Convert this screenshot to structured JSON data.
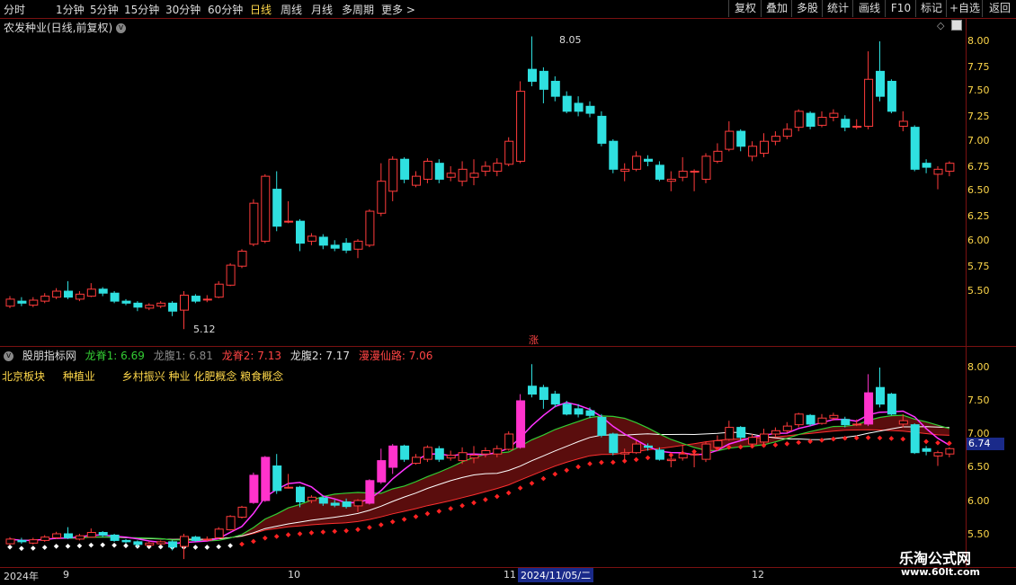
{
  "toolbar": {
    "timeframes": [
      "分时",
      "1分钟",
      "5分钟",
      "15分钟",
      "30分钟",
      "60分钟",
      "日线",
      "周线",
      "月线",
      "多周期",
      "更多"
    ],
    "active": "日线",
    "right_buttons": [
      "复权",
      "叠加",
      "多股",
      "统计",
      "画线",
      "F10",
      "标记",
      "+自选",
      "返回"
    ]
  },
  "main": {
    "title": "农发种业(日线,前复权)",
    "high_label": "8.05",
    "low_label": "5.12",
    "zhang_label": "涨",
    "y_ticks": [
      "8.00",
      "7.75",
      "7.50",
      "7.25",
      "7.00",
      "6.75",
      "6.50",
      "6.25",
      "6.00",
      "5.75",
      "5.50"
    ]
  },
  "indicator": {
    "name": "股朋指标网",
    "fields": [
      {
        "label": "龙脊1: 6.69",
        "color": "#33cc33"
      },
      {
        "label": "龙腹1: 6.81",
        "color": "#888888"
      },
      {
        "label": "龙脊2: 7.13",
        "color": "#ff4444"
      },
      {
        "label": "龙腹2: 7.17",
        "color": "#dddddd"
      },
      {
        "label": "漫漫仙路: 7.06",
        "color": "#ff4444"
      }
    ],
    "concepts": [
      "北京板块",
      "种植业",
      "乡村振兴 种业 化肥概念 粮食概念"
    ],
    "y_ticks": [
      "8.00",
      "7.50",
      "7.00",
      "6.50",
      "6.00",
      "5.50"
    ],
    "current_value": "6.74"
  },
  "xaxis": {
    "labels": [
      "2024年",
      "9",
      "10",
      "11",
      "12"
    ],
    "selected_date": "2024/11/05/二"
  },
  "watermark": {
    "line1": "乐淘公式网",
    "line2": "www.60lt.com"
  },
  "chart_data": {
    "type": "candlestick",
    "title": "农发种业(日线,前复权)",
    "ylim": [
      5.4,
      8.1
    ],
    "candles": [
      [
        5.35,
        5.42,
        5.45,
        5.33
      ],
      [
        5.4,
        5.38,
        5.44,
        5.35
      ],
      [
        5.36,
        5.41,
        5.44,
        5.34
      ],
      [
        5.4,
        5.45,
        5.48,
        5.38
      ],
      [
        5.44,
        5.5,
        5.53,
        5.42
      ],
      [
        5.5,
        5.44,
        5.6,
        5.42
      ],
      [
        5.42,
        5.47,
        5.5,
        5.4
      ],
      [
        5.45,
        5.52,
        5.58,
        5.44
      ],
      [
        5.52,
        5.48,
        5.54,
        5.45
      ],
      [
        5.48,
        5.4,
        5.5,
        5.38
      ],
      [
        5.4,
        5.38,
        5.42,
        5.36
      ],
      [
        5.38,
        5.34,
        5.4,
        5.3
      ],
      [
        5.33,
        5.36,
        5.38,
        5.31
      ],
      [
        5.35,
        5.38,
        5.4,
        5.33
      ],
      [
        5.38,
        5.3,
        5.4,
        5.25
      ],
      [
        5.31,
        5.46,
        5.5,
        5.12
      ],
      [
        5.45,
        5.4,
        5.47,
        5.38
      ],
      [
        5.42,
        5.42,
        5.46,
        5.39
      ],
      [
        5.44,
        5.57,
        5.6,
        5.43
      ],
      [
        5.56,
        5.76,
        5.78,
        5.55
      ],
      [
        5.75,
        5.9,
        5.92,
        5.73
      ],
      [
        5.97,
        6.38,
        6.42,
        5.95
      ],
      [
        6.0,
        6.65,
        6.67,
        5.98
      ],
      [
        6.52,
        6.15,
        6.7,
        6.1
      ],
      [
        6.2,
        6.2,
        6.4,
        6.18
      ],
      [
        6.2,
        5.98,
        6.22,
        5.9
      ],
      [
        6.0,
        6.05,
        6.08,
        5.96
      ],
      [
        6.04,
        5.96,
        6.07,
        5.92
      ],
      [
        5.96,
        5.93,
        6.01,
        5.9
      ],
      [
        5.98,
        5.91,
        6.03,
        5.88
      ],
      [
        5.92,
        6.0,
        6.02,
        5.83
      ],
      [
        5.96,
        6.3,
        6.32,
        5.94
      ],
      [
        6.28,
        6.6,
        6.78,
        6.25
      ],
      [
        6.5,
        6.82,
        6.85,
        6.4
      ],
      [
        6.82,
        6.62,
        6.84,
        6.58
      ],
      [
        6.56,
        6.65,
        6.7,
        6.54
      ],
      [
        6.62,
        6.8,
        6.83,
        6.58
      ],
      [
        6.78,
        6.62,
        6.82,
        6.58
      ],
      [
        6.64,
        6.68,
        6.75,
        6.6
      ],
      [
        6.6,
        6.72,
        6.8,
        6.55
      ],
      [
        6.64,
        6.68,
        6.82,
        6.56
      ],
      [
        6.7,
        6.75,
        6.8,
        6.65
      ],
      [
        6.7,
        6.78,
        6.83,
        6.65
      ],
      [
        6.77,
        7.0,
        7.04,
        6.75
      ],
      [
        6.8,
        7.5,
        7.6,
        6.78
      ],
      [
        7.72,
        7.6,
        8.05,
        7.55
      ],
      [
        7.7,
        7.52,
        7.74,
        7.38
      ],
      [
        7.6,
        7.45,
        7.65,
        7.4
      ],
      [
        7.45,
        7.3,
        7.5,
        7.28
      ],
      [
        7.38,
        7.3,
        7.45,
        7.25
      ],
      [
        7.35,
        7.28,
        7.4,
        7.24
      ],
      [
        7.25,
        6.98,
        7.3,
        6.95
      ],
      [
        7.0,
        6.72,
        7.02,
        6.68
      ],
      [
        6.7,
        6.72,
        6.78,
        6.6
      ],
      [
        6.72,
        6.85,
        6.9,
        6.7
      ],
      [
        6.82,
        6.8,
        6.86,
        6.75
      ],
      [
        6.76,
        6.62,
        6.8,
        6.6
      ],
      [
        6.6,
        6.62,
        6.7,
        6.5
      ],
      [
        6.64,
        6.7,
        6.84,
        6.6
      ],
      [
        6.7,
        6.7,
        6.72,
        6.5
      ],
      [
        6.62,
        6.85,
        6.88,
        6.58
      ],
      [
        6.8,
        6.9,
        6.98,
        6.78
      ],
      [
        6.92,
        7.1,
        7.2,
        6.9
      ],
      [
        7.1,
        6.95,
        7.12,
        6.9
      ],
      [
        6.85,
        6.95,
        7.0,
        6.8
      ],
      [
        6.88,
        7.0,
        7.08,
        6.84
      ],
      [
        7.0,
        7.05,
        7.1,
        6.96
      ],
      [
        7.05,
        7.12,
        7.18,
        7.02
      ],
      [
        7.14,
        7.3,
        7.32,
        7.1
      ],
      [
        7.28,
        7.15,
        7.3,
        7.12
      ],
      [
        7.16,
        7.24,
        7.3,
        7.14
      ],
      [
        7.24,
        7.28,
        7.32,
        7.2
      ],
      [
        7.22,
        7.14,
        7.26,
        7.1
      ],
      [
        7.15,
        7.15,
        7.22,
        7.12
      ],
      [
        7.15,
        7.62,
        7.9,
        7.12
      ],
      [
        7.7,
        7.45,
        8.0,
        7.4
      ],
      [
        7.6,
        7.3,
        7.62,
        7.28
      ],
      [
        7.15,
        7.2,
        7.3,
        7.1
      ],
      [
        7.14,
        6.72,
        7.16,
        6.7
      ],
      [
        6.78,
        6.74,
        6.82,
        6.68
      ],
      [
        6.67,
        6.72,
        6.75,
        6.52
      ],
      [
        6.7,
        6.78,
        6.8,
        6.65
      ]
    ]
  }
}
